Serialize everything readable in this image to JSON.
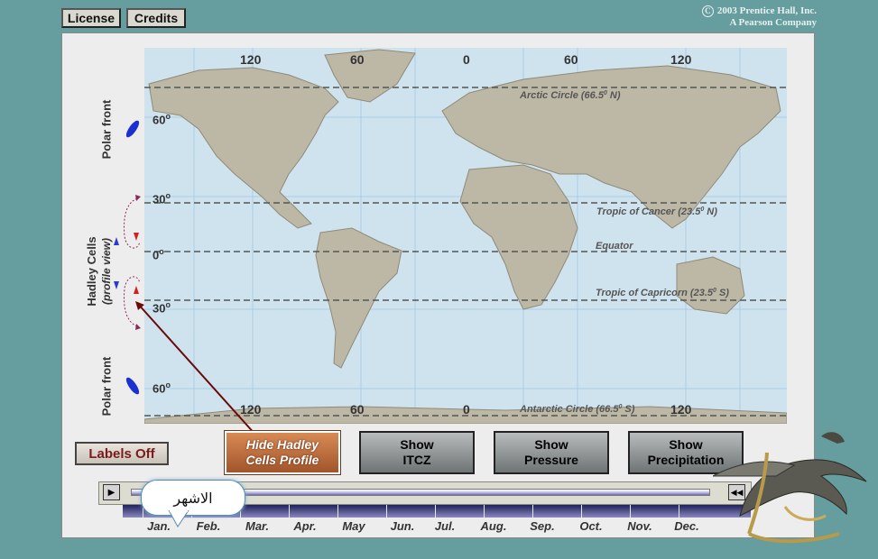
{
  "top_buttons": {
    "license": "License",
    "credits": "Credits"
  },
  "copyright": {
    "symbol": "C",
    "line1": "2003 Prentice Hall, Inc.",
    "line2": "A Pearson Company"
  },
  "side_labels": {
    "polar_front_top": "Polar front",
    "hadley_cells": "Hadley Cells",
    "profile_view": "(profile view)",
    "polar_front_bottom": "Polar front"
  },
  "latitudes": [
    {
      "label": "60",
      "sup": "o"
    },
    {
      "label": "30",
      "sup": "o"
    },
    {
      "label": "0",
      "sup": "o"
    },
    {
      "label": "30",
      "sup": "o"
    },
    {
      "label": "60",
      "sup": "o"
    }
  ],
  "longitudes_top": [
    "120",
    "60",
    "0",
    "60",
    "120"
  ],
  "longitudes_bottom": [
    "120",
    "60",
    "0",
    "120"
  ],
  "map_lines": {
    "arctic": "Arctic Circle (66.5",
    "arctic_end": " N)",
    "cancer": "Tropic of Cancer (23.5",
    "cancer_end": " N)",
    "equator": "Equator",
    "capricorn": "Tropic of Capricorn (23.5",
    "capricorn_end": " S)",
    "antarctic": "Antarctic Circle (66.5",
    "antarctic_end": " S)",
    "degree": "0"
  },
  "controls": {
    "labels_off": "Labels Off",
    "hide_hadley_1": "Hide Hadley",
    "hide_hadley_2": "Cells Profile",
    "show_itcz_1": "Show",
    "show_itcz_2": "ITCZ",
    "show_pressure_1": "Show",
    "show_pressure_2": "Pressure",
    "show_precip_1": "Show",
    "show_precip_2": "Precipitation"
  },
  "timeline": {
    "play": "▶",
    "rewind": "◀◀",
    "months": [
      "Jan.",
      "Feb.",
      "Mar.",
      "Apr.",
      "May",
      "Jun.",
      "Jul.",
      "Aug.",
      "Sep.",
      "Oct.",
      "Nov.",
      "Dec."
    ]
  },
  "tooltip": "الاشهر",
  "colors": {
    "background": "#669d9e",
    "ocean": "#cfe3ef",
    "land": "#bdb8a6",
    "active_button": "#c06a3a"
  }
}
